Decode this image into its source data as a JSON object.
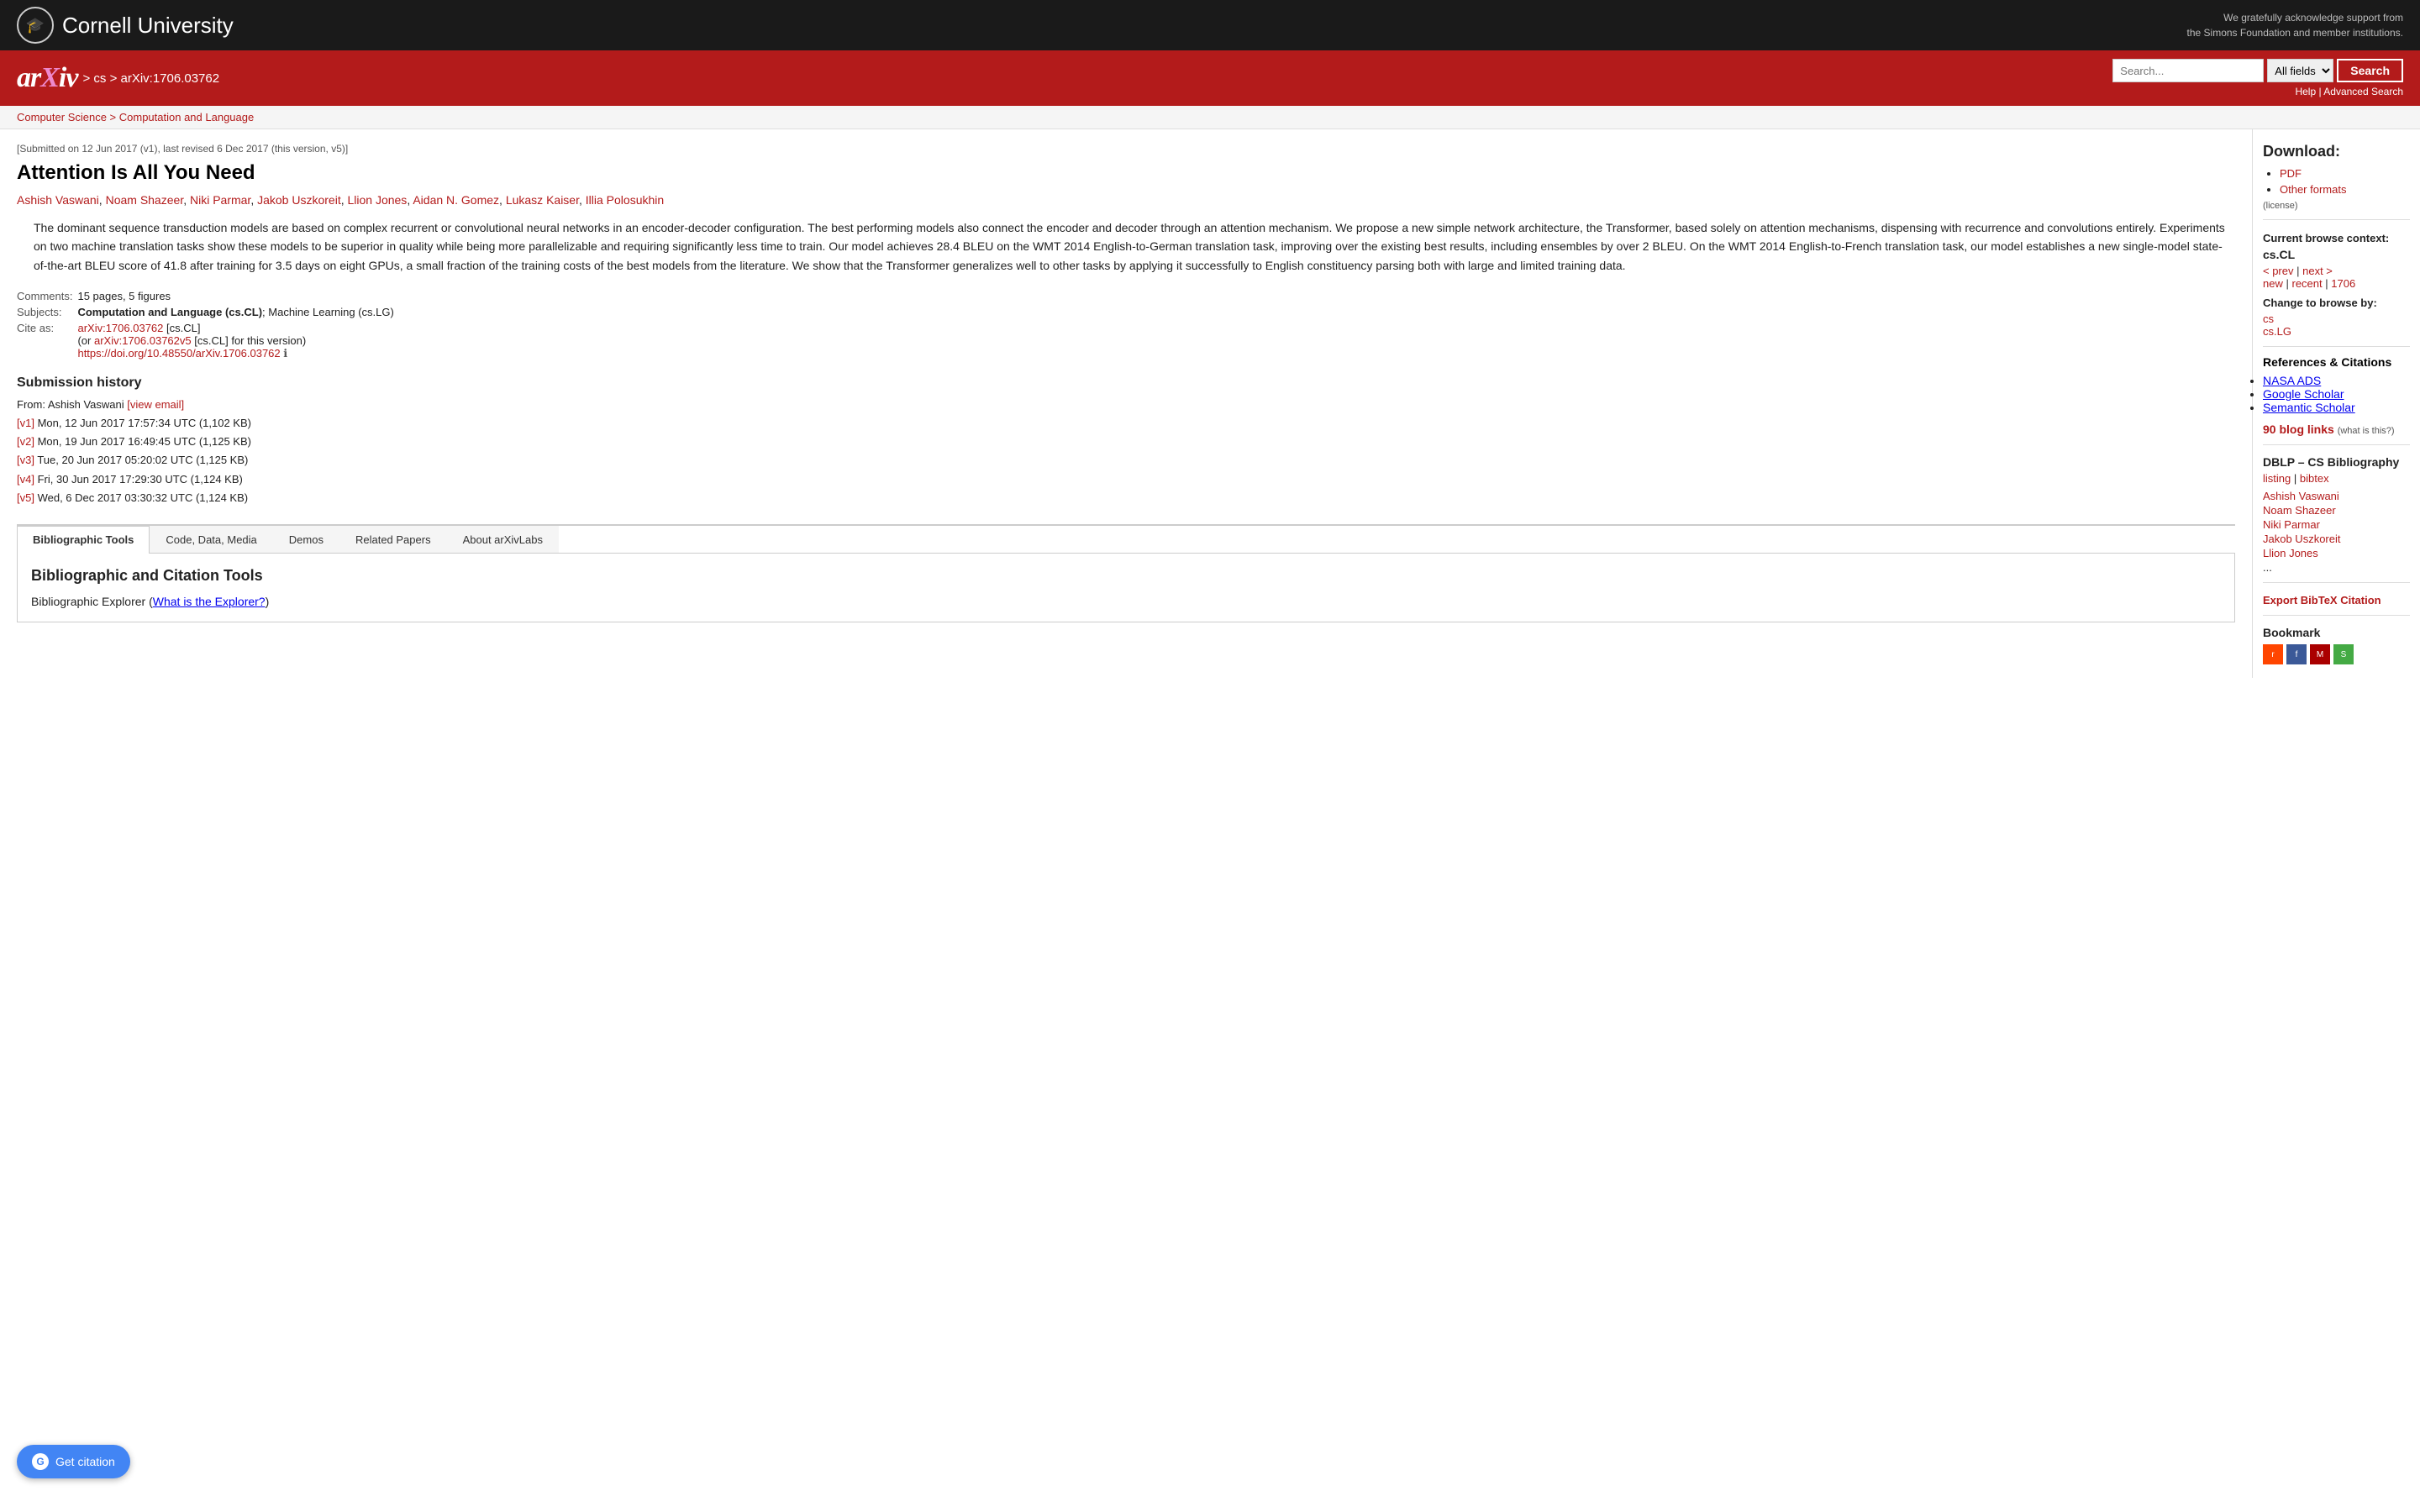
{
  "topbar": {
    "cornell_name": "Cornell University",
    "support_text": "We gratefully acknowledge support from\nthe Simons Foundation and member institutions."
  },
  "header": {
    "arxiv_logo": "arXiv",
    "breadcrumb": "> cs > arXiv:1706.03762",
    "search_placeholder": "Search...",
    "search_field_default": "All fields",
    "search_button_label": "Search",
    "help_label": "Help",
    "advanced_search_label": "Advanced Search"
  },
  "subject_breadcrumb": "Computer Science > Computation and Language",
  "paper": {
    "submission_date": "[Submitted on 12 Jun 2017 (v1), last revised 6 Dec 2017 (this version, v5)]",
    "title": "Attention Is All You Need",
    "authors": [
      "Ashish Vaswani",
      "Noam Shazeer",
      "Niki Parmar",
      "Jakob Uszkoreit",
      "Llion Jones",
      "Aidan N. Gomez",
      "Lukasz Kaiser",
      "Illia Polosukhin"
    ],
    "abstract": "The dominant sequence transduction models are based on complex recurrent or convolutional neural networks in an encoder-decoder configuration. The best performing models also connect the encoder and decoder through an attention mechanism. We propose a new simple network architecture, the Transformer, based solely on attention mechanisms, dispensing with recurrence and convolutions entirely. Experiments on two machine translation tasks show these models to be superior in quality while being more parallelizable and requiring significantly less time to train. Our model achieves 28.4 BLEU on the WMT 2014 English-to-German translation task, improving over the existing best results, including ensembles by over 2 BLEU. On the WMT 2014 English-to-French translation task, our model establishes a new single-model state-of-the-art BLEU score of 41.8 after training for 3.5 days on eight GPUs, a small fraction of the training costs of the best models from the literature. We show that the Transformer generalizes well to other tasks by applying it successfully to English constituency parsing both with large and limited training data.",
    "comments": "15 pages, 5 figures",
    "subjects": "Computation and Language (cs.CL); Machine Learning (cs.LG)",
    "cite_as_arxiv": "arXiv:1706.03762",
    "cite_as_cs_cl": "[cs.CL]",
    "cite_as_v5": "arXiv:1706.03762v5",
    "cite_as_v5_cs_cl": "[cs.CL]",
    "cite_as_v5_suffix": "for this version)",
    "doi": "https://doi.org/10.48550/arXiv.1706.03762",
    "submission_history_title": "Submission history",
    "from_label": "From: Ashish Vaswani",
    "view_email": "[view email]",
    "versions": [
      {
        "label": "[v1]",
        "text": "Mon, 12 Jun 2017 17:57:34 UTC (1,102 KB)"
      },
      {
        "label": "[v2]",
        "text": "Mon, 19 Jun 2017 16:49:45 UTC (1,125 KB)"
      },
      {
        "label": "[v3]",
        "text": "Tue, 20 Jun 2017 05:20:02 UTC (1,125 KB)"
      },
      {
        "label": "[v4]",
        "text": "Fri, 30 Jun 2017 17:29:30 UTC (1,124 KB)"
      },
      {
        "label": "[v5]",
        "text": "Wed, 6 Dec 2017 03:30:32 UTC (1,124 KB)"
      }
    ]
  },
  "tabs": [
    {
      "id": "bibliographic-tools",
      "label": "Bibliographic Tools",
      "active": true
    },
    {
      "id": "code-data-media",
      "label": "Code, Data, Media",
      "active": false
    },
    {
      "id": "demos",
      "label": "Demos",
      "active": false
    },
    {
      "id": "related-papers",
      "label": "Related Papers",
      "active": false
    },
    {
      "id": "about-arxivlabs",
      "label": "About arXivLabs",
      "active": false
    }
  ],
  "tab_content": {
    "bib_tools_title": "Bibliographic and Citation Tools",
    "bib_explorer_label": "Bibliographic Explorer",
    "bib_explorer_link_text": "What is the Explorer?"
  },
  "sidebar": {
    "download_title": "Download:",
    "pdf_label": "PDF",
    "other_formats_label": "Other formats",
    "license_text": "(license)",
    "browse_context_title": "Current browse context:",
    "browse_context_value": "cs.CL",
    "prev_label": "< prev",
    "next_label": "next >",
    "new_label": "new",
    "recent_label": "recent",
    "version_label": "1706",
    "change_browse_title": "Change to browse by:",
    "browse_cs": "cs",
    "browse_cs_lg": "cs.LG",
    "refs_citations_title": "References & Citations",
    "nasa_ads": "NASA ADS",
    "google_scholar": "Google Scholar",
    "semantic_scholar": "Semantic Scholar",
    "blog_links_count": "90 blog links",
    "blog_links_what": "(what is this?)",
    "dblp_title": "DBLP – CS Bibliography",
    "dblp_listing": "listing",
    "dblp_bibtex": "bibtex",
    "dblp_authors": [
      "Ashish Vaswani",
      "Noam Shazeer",
      "Niki Parmar",
      "Jakob Uszkoreit",
      "Llion Jones"
    ],
    "dblp_ellipsis": "...",
    "export_bibtex_label": "Export BibTeX Citation",
    "bookmark_title": "Bookmark",
    "bookmark_icons": [
      "reddit",
      "facebook",
      "mendeley",
      "sciencewise"
    ]
  },
  "get_citation_btn": "Get citation"
}
